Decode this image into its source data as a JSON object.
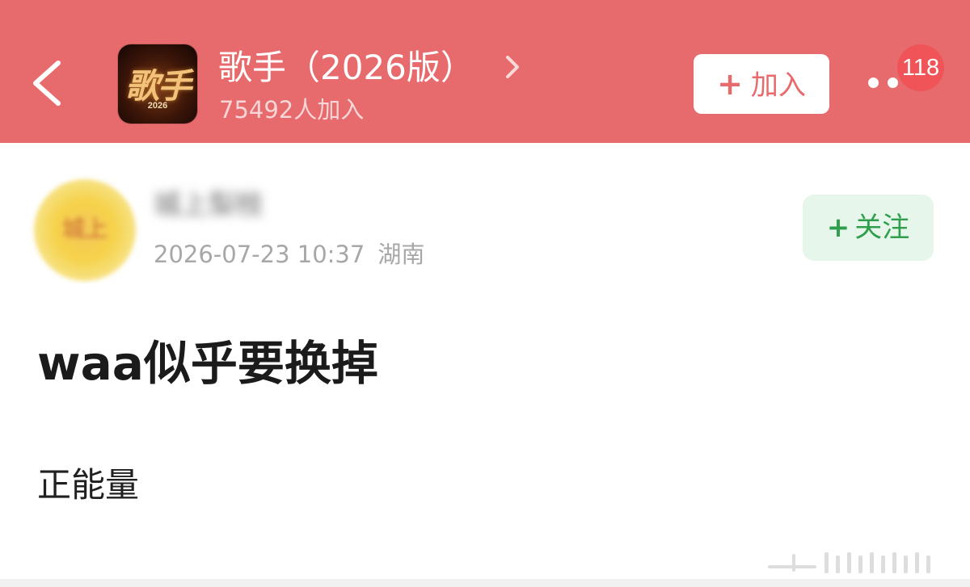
{
  "header": {
    "background_color": "#e76a6c",
    "back_icon": "chevron-left-icon",
    "logo": {
      "text": "歌手",
      "year": "2026"
    },
    "title": "歌手（2026版）",
    "title_chevron_icon": "chevron-right-icon",
    "member_count": "75492人加入",
    "join_button": {
      "plus": "+",
      "label": "加入"
    },
    "more_icon": "more-dots-icon",
    "badge_count": "118"
  },
  "post": {
    "author": {
      "avatar_text": "城上",
      "name": "城上梨枝"
    },
    "datetime": "2026-07-23 10:37",
    "location": "湖南",
    "follow_button": {
      "plus": "+",
      "label": "关注",
      "color": "#2f9f4d"
    },
    "title": "waa似乎要换掉",
    "body": "正能量"
  }
}
